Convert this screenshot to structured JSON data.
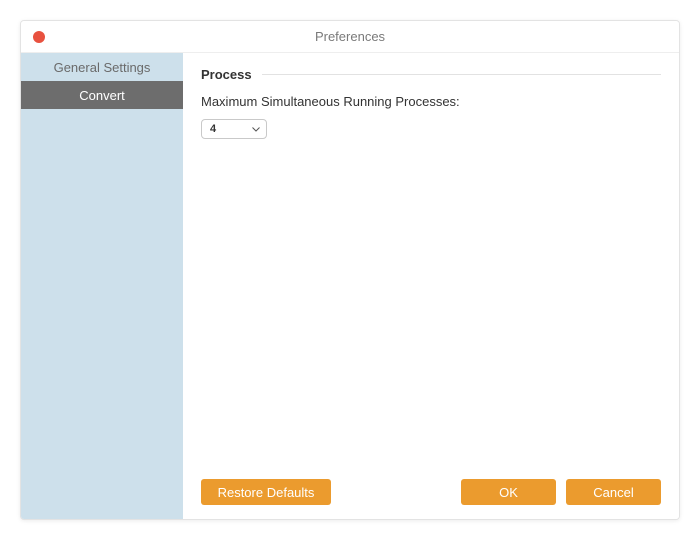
{
  "window": {
    "title": "Preferences"
  },
  "sidebar": {
    "items": [
      {
        "label": "General Settings",
        "selected": false
      },
      {
        "label": "Convert",
        "selected": true
      }
    ]
  },
  "main": {
    "section_title": "Process",
    "max_processes_label": "Maximum Simultaneous Running Processes:",
    "max_processes_value": "4"
  },
  "buttons": {
    "restore_defaults": "Restore Defaults",
    "ok": "OK",
    "cancel": "Cancel"
  },
  "colors": {
    "accent": "#eb9b2e",
    "sidebar_bg": "#cde0eb",
    "sidebar_selected": "#6d6d6d"
  }
}
